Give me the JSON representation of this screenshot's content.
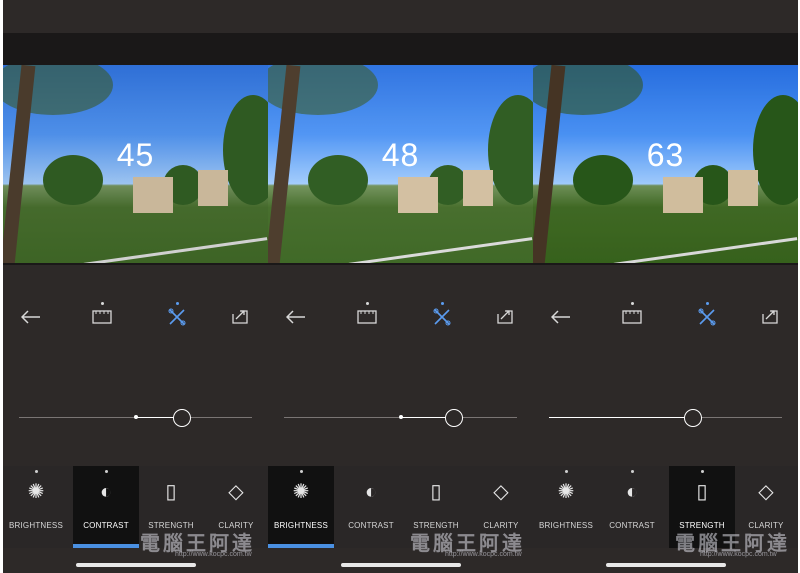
{
  "screens": [
    {
      "value": "45",
      "active_tab": "CONTRAST",
      "slider_fraction": 0.7
    },
    {
      "value": "48",
      "active_tab": "BRIGHTNESS",
      "slider_fraction": 0.73
    },
    {
      "value": "63",
      "active_tab": "STRENGTH",
      "slider_fraction": 0.62
    }
  ],
  "tabs": [
    {
      "label": "BRIGHTNESS",
      "icon": "sun-icon"
    },
    {
      "label": "CONTRAST",
      "icon": "contrast-icon"
    },
    {
      "label": "STRENGTH",
      "icon": "film-icon"
    },
    {
      "label": "CLARITY",
      "icon": "diamond-icon"
    }
  ],
  "toolbar": {
    "back_icon": "back-arrow-icon",
    "filter_icon": "film-frame-icon",
    "tools_icon": "tools-icon",
    "share_icon": "share-icon"
  },
  "watermark": {
    "text": "電腦王阿達",
    "url": "http://www.kocpc.com.tw"
  },
  "colors": {
    "accent": "#4a90e2",
    "background": "#2d2928",
    "active_icon": "#5b9cf0"
  }
}
